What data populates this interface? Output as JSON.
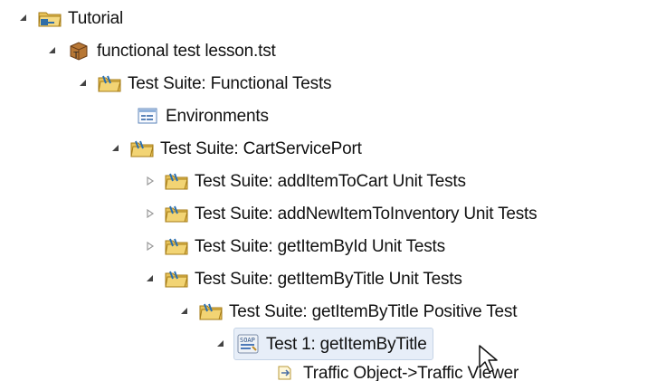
{
  "tree": {
    "items": [
      {
        "label": "Tutorial",
        "icon": "project-folder-icon",
        "expanded": true
      },
      {
        "label": "functional test lesson.tst",
        "icon": "test-file-icon",
        "expanded": true
      },
      {
        "label": "Test Suite: Functional Tests",
        "icon": "test-suite-folder-icon",
        "expanded": true
      },
      {
        "label": "Environments",
        "icon": "environments-icon",
        "expanded": null
      },
      {
        "label": "Test Suite: CartServicePort",
        "icon": "test-suite-folder-icon",
        "expanded": true
      },
      {
        "label": "Test Suite: addItemToCart Unit Tests",
        "icon": "test-suite-folder-icon",
        "expanded": false
      },
      {
        "label": "Test Suite: addNewItemToInventory Unit Tests",
        "icon": "test-suite-folder-icon",
        "expanded": false
      },
      {
        "label": "Test Suite: getItemById Unit Tests",
        "icon": "test-suite-folder-icon",
        "expanded": false
      },
      {
        "label": "Test Suite: getItemByTitle Unit Tests",
        "icon": "test-suite-folder-icon",
        "expanded": true
      },
      {
        "label": "Test Suite: getItemByTitle Positive Test",
        "icon": "test-suite-folder-icon",
        "expanded": true
      },
      {
        "label": "Test 1: getItemByTitle",
        "icon": "soap-test-icon",
        "icon_text": "SOAP",
        "expanded": true,
        "selected": true
      },
      {
        "label": "Traffic Object->Traffic Viewer",
        "icon": "traffic-object-icon",
        "expanded": null
      }
    ]
  },
  "colors": {
    "folder": "#e8c35a",
    "folder_stroke": "#a57b16",
    "selection_bg": "#e7eef8",
    "selection_border": "#c6d4e6",
    "expanded_arrow": "#444444",
    "collapsed_arrow": "#9a9a9a"
  }
}
